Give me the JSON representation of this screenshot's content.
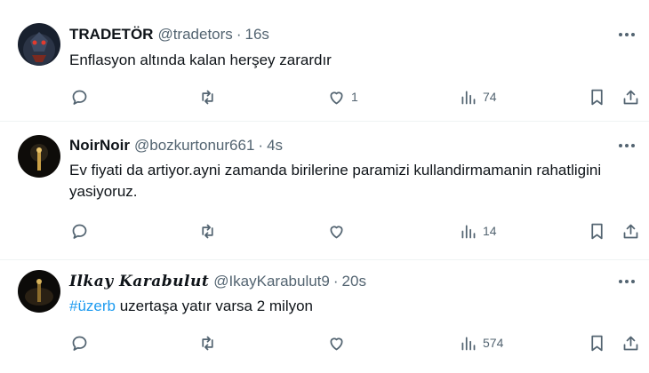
{
  "tweets": [
    {
      "name": "TRADETÖR",
      "handle": "@tradetors",
      "time": "16s",
      "text": "Enflasyon altında kalan herşey zarardır",
      "likes": "1",
      "views": "74",
      "avatar_colors": [
        "#1a2233",
        "#c0392b"
      ]
    },
    {
      "name": "NoirNoir",
      "handle": "@bozkurtonur661",
      "time": "4s",
      "text": "Ev fiyati da artiyor.ayni zamanda birilerine paramizi kullandirmamanin rahatligini yasiyoruz.",
      "likes": "",
      "views": "14",
      "avatar_colors": [
        "#0d0b08",
        "#d9a43a"
      ]
    },
    {
      "name": "Ilkay Karabulut",
      "handle": "@IkayKarabulut9",
      "time": "20s",
      "hashtag": "#üzerb",
      "text": " uzertaşa yatır varsa 2 milyon",
      "likes": "",
      "views": "574",
      "avatar_colors": [
        "#0b0a08",
        "#8a6a2a"
      ]
    }
  ],
  "separator": "·",
  "colors": {
    "text": "#0f1419",
    "muted": "#536471",
    "link": "#1d9bf0",
    "divider": "#eff3f4"
  },
  "icons": [
    "reply-icon",
    "retweet-icon",
    "like-icon",
    "views-icon",
    "bookmark-icon",
    "share-icon",
    "more-icon"
  ]
}
